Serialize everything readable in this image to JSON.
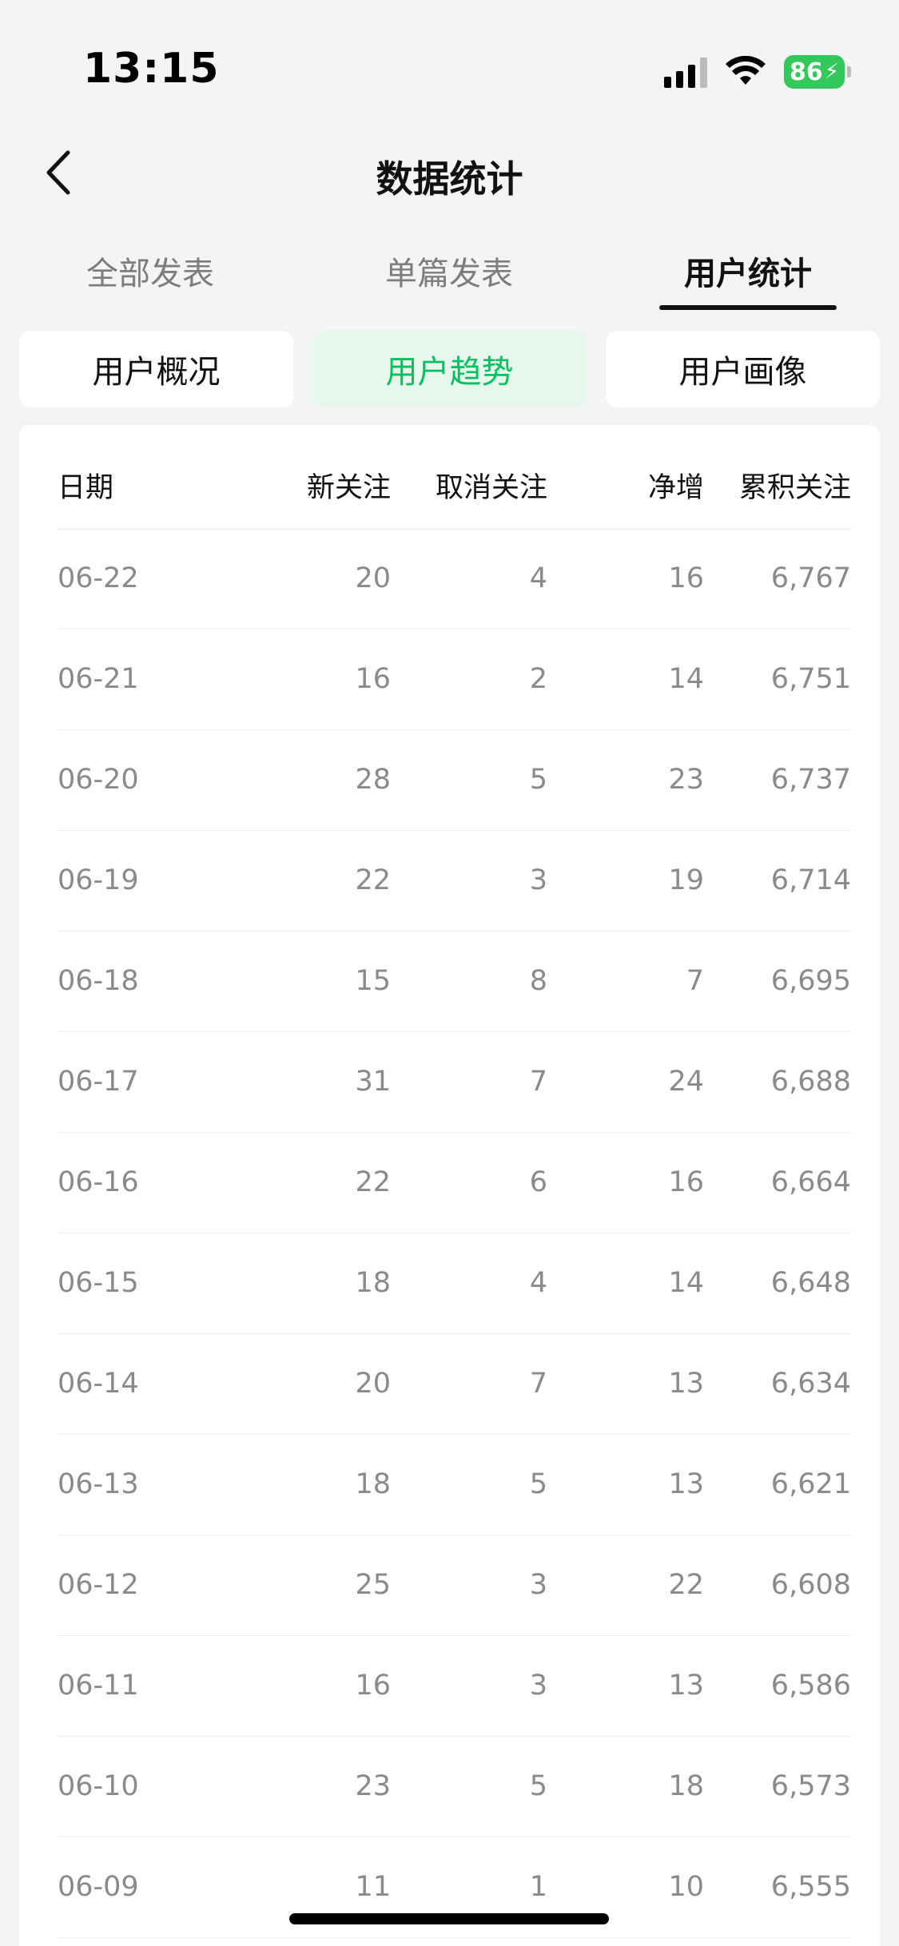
{
  "status_bar": {
    "time": "13:15",
    "battery": "86"
  },
  "navbar": {
    "title": "数据统计"
  },
  "tabs": [
    {
      "label": "全部发表",
      "active": false
    },
    {
      "label": "单篇发表",
      "active": false
    },
    {
      "label": "用户统计",
      "active": true
    }
  ],
  "segments": [
    {
      "label": "用户概况",
      "active": false
    },
    {
      "label": "用户趋势",
      "active": true
    },
    {
      "label": "用户画像",
      "active": false
    }
  ],
  "colors": {
    "accent_green": "#07c160",
    "accent_bg": "#e7f7ee",
    "battery_green": "#34c759"
  },
  "table": {
    "headers": {
      "date": "日期",
      "new_follow": "新关注",
      "unfollow": "取消关注",
      "net": "净增",
      "total": "累积关注"
    },
    "rows": [
      {
        "date": "06-22",
        "new_follow": "20",
        "unfollow": "4",
        "net": "16",
        "total": "6,767"
      },
      {
        "date": "06-21",
        "new_follow": "16",
        "unfollow": "2",
        "net": "14",
        "total": "6,751"
      },
      {
        "date": "06-20",
        "new_follow": "28",
        "unfollow": "5",
        "net": "23",
        "total": "6,737"
      },
      {
        "date": "06-19",
        "new_follow": "22",
        "unfollow": "3",
        "net": "19",
        "total": "6,714"
      },
      {
        "date": "06-18",
        "new_follow": "15",
        "unfollow": "8",
        "net": "7",
        "total": "6,695"
      },
      {
        "date": "06-17",
        "new_follow": "31",
        "unfollow": "7",
        "net": "24",
        "total": "6,688"
      },
      {
        "date": "06-16",
        "new_follow": "22",
        "unfollow": "6",
        "net": "16",
        "total": "6,664"
      },
      {
        "date": "06-15",
        "new_follow": "18",
        "unfollow": "4",
        "net": "14",
        "total": "6,648"
      },
      {
        "date": "06-14",
        "new_follow": "20",
        "unfollow": "7",
        "net": "13",
        "total": "6,634"
      },
      {
        "date": "06-13",
        "new_follow": "18",
        "unfollow": "5",
        "net": "13",
        "total": "6,621"
      },
      {
        "date": "06-12",
        "new_follow": "25",
        "unfollow": "3",
        "net": "22",
        "total": "6,608"
      },
      {
        "date": "06-11",
        "new_follow": "16",
        "unfollow": "3",
        "net": "13",
        "total": "6,586"
      },
      {
        "date": "06-10",
        "new_follow": "23",
        "unfollow": "5",
        "net": "18",
        "total": "6,573"
      },
      {
        "date": "06-09",
        "new_follow": "11",
        "unfollow": "1",
        "net": "10",
        "total": "6,555"
      }
    ]
  }
}
